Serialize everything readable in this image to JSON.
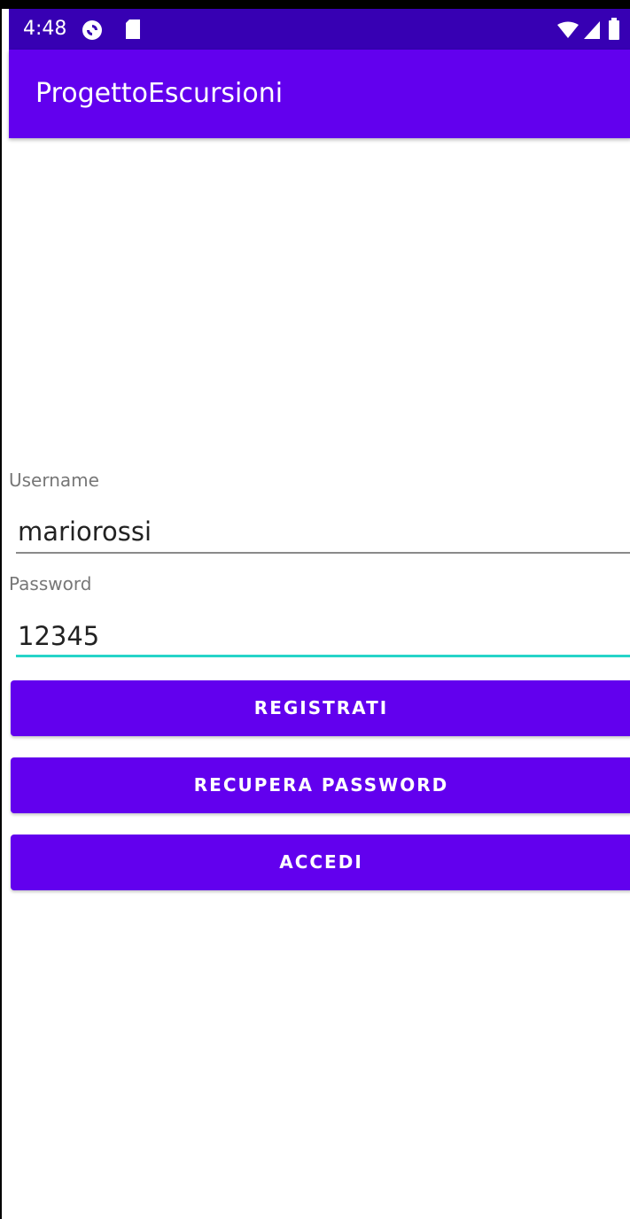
{
  "status_bar": {
    "time": "4:48",
    "left_icons": [
      "pocket-casts-icon",
      "sd-card-icon"
    ],
    "right_icons": [
      "wifi-icon",
      "cell-signal-icon",
      "battery-icon"
    ]
  },
  "app_bar": {
    "title": "ProgettoEscursioni"
  },
  "form": {
    "username": {
      "label": "Username",
      "value": "mariorossi"
    },
    "password": {
      "label": "Password",
      "value": "12345"
    }
  },
  "buttons": {
    "register": "REGISTRATI",
    "recover_password": "RECUPERA PASSWORD",
    "login": "ACCEDI"
  },
  "colors": {
    "status_bar": "#3700B3",
    "primary": "#6200EE",
    "focused_underline": "#26D4C8",
    "underline": "#8A8A8A",
    "label": "#777777"
  }
}
